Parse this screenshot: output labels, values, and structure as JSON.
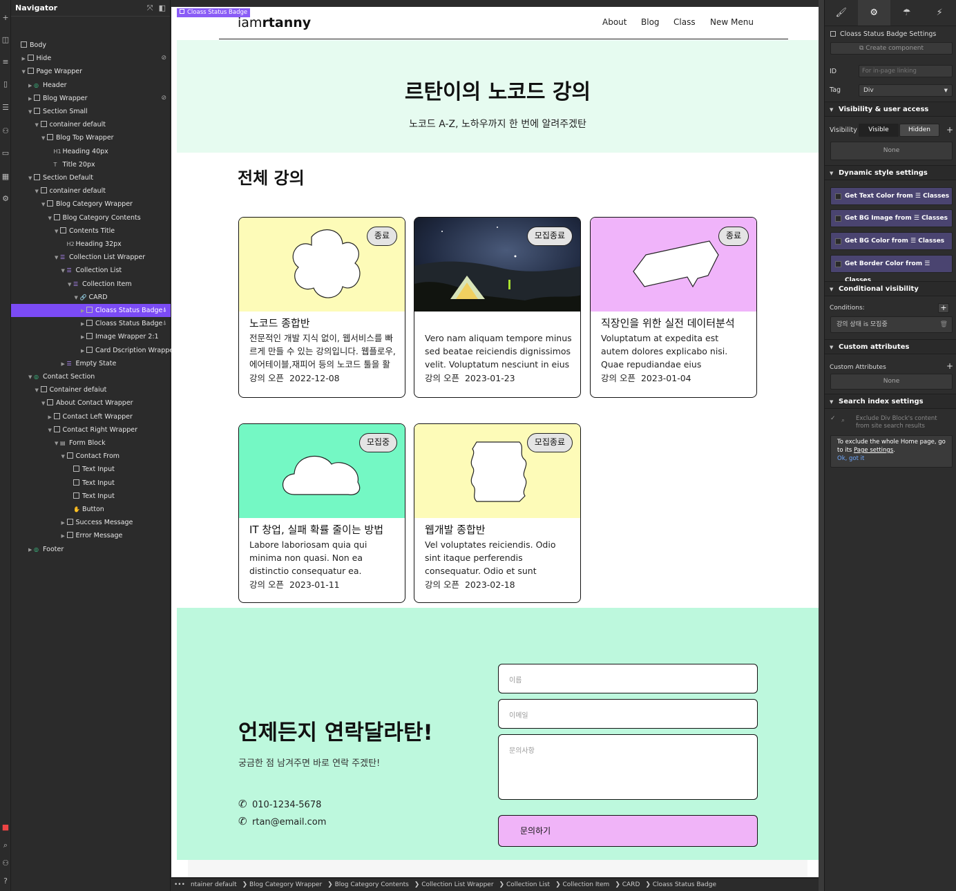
{
  "navigator": {
    "title": "Navigator",
    "items": [
      {
        "label": "Body",
        "glyph": "box",
        "indent": 0,
        "caret": false
      },
      {
        "label": "Hide",
        "glyph": "box",
        "indent": 1,
        "caret": true,
        "hidden": true
      },
      {
        "label": "Page Wrapper",
        "glyph": "box",
        "indent": 1,
        "caret": true,
        "open": true
      },
      {
        "label": "Header",
        "glyph": "comp",
        "indent": 2,
        "caret": true
      },
      {
        "label": "Blog Wrapper",
        "glyph": "box",
        "indent": 2,
        "caret": true,
        "hidden": true
      },
      {
        "label": "Section Small",
        "glyph": "box",
        "indent": 2,
        "caret": true,
        "open": true
      },
      {
        "label": "container default",
        "glyph": "box",
        "indent": 3,
        "caret": true,
        "open": true
      },
      {
        "label": "Blog Top Wrapper",
        "glyph": "box",
        "indent": 4,
        "caret": true,
        "open": true
      },
      {
        "label": "Heading 40px",
        "glyph": "H1",
        "indent": 5,
        "caret": false
      },
      {
        "label": "Title 20px",
        "glyph": "T",
        "indent": 5,
        "caret": false
      },
      {
        "label": "Section Default",
        "glyph": "box",
        "indent": 2,
        "caret": true,
        "open": true
      },
      {
        "label": "container default",
        "glyph": "box",
        "indent": 3,
        "caret": true,
        "open": true
      },
      {
        "label": "Blog Category Wrapper",
        "glyph": "box",
        "indent": 4,
        "caret": true,
        "open": true
      },
      {
        "label": "Blog Category Contents",
        "glyph": "box",
        "indent": 5,
        "caret": true,
        "open": true
      },
      {
        "label": "Contents Title",
        "glyph": "box",
        "indent": 6,
        "caret": true,
        "open": true
      },
      {
        "label": "Heading 32px",
        "glyph": "H2",
        "indent": 7,
        "caret": false
      },
      {
        "label": "Collection List Wrapper",
        "glyph": "db",
        "indent": 6,
        "caret": true,
        "open": true
      },
      {
        "label": "Collection List",
        "glyph": "db",
        "indent": 7,
        "caret": true,
        "open": true
      },
      {
        "label": "Collection Item",
        "glyph": "db",
        "indent": 8,
        "caret": true,
        "open": true
      },
      {
        "label": "CARD",
        "glyph": "link",
        "indent": 9,
        "caret": true,
        "open": true
      },
      {
        "label": "Cloass Status Badge",
        "glyph": "box",
        "indent": 10,
        "caret": true,
        "selected": true,
        "cond": true
      },
      {
        "label": "Cloass Status Badge",
        "glyph": "box",
        "indent": 10,
        "caret": true,
        "cond": true
      },
      {
        "label": "Image Wrapper 2:1",
        "glyph": "box",
        "indent": 10,
        "caret": true
      },
      {
        "label": "Card Dscription Wrapper",
        "glyph": "box",
        "indent": 10,
        "caret": true
      },
      {
        "label": "Empty State",
        "glyph": "db",
        "indent": 7,
        "caret": true
      },
      {
        "label": "Contact Section",
        "glyph": "comp",
        "indent": 2,
        "caret": true,
        "open": true
      },
      {
        "label": "Container defaiut",
        "glyph": "box",
        "indent": 3,
        "caret": true,
        "open": true
      },
      {
        "label": "About Contact Wrapper",
        "glyph": "box",
        "indent": 4,
        "caret": true,
        "open": true
      },
      {
        "label": "Contact Left Wrapper",
        "glyph": "box",
        "indent": 5,
        "caret": true
      },
      {
        "label": "Contact Right Wrapper",
        "glyph": "box",
        "indent": 5,
        "caret": true,
        "open": true
      },
      {
        "label": "Form Block",
        "glyph": "form",
        "indent": 6,
        "caret": true,
        "open": true
      },
      {
        "label": "Contact From",
        "glyph": "box",
        "indent": 7,
        "caret": true,
        "open": true
      },
      {
        "label": "Text Input",
        "glyph": "box",
        "indent": 8,
        "caret": false
      },
      {
        "label": "Text Input",
        "glyph": "box",
        "indent": 8,
        "caret": false
      },
      {
        "label": "Text Input",
        "glyph": "box",
        "indent": 8,
        "caret": false
      },
      {
        "label": "Button",
        "glyph": "hand",
        "indent": 8,
        "caret": false
      },
      {
        "label": "Success Message",
        "glyph": "box",
        "indent": 7,
        "caret": true
      },
      {
        "label": "Error Message",
        "glyph": "box",
        "indent": 7,
        "caret": true
      },
      {
        "label": "Footer",
        "glyph": "comp",
        "indent": 2,
        "caret": true
      }
    ]
  },
  "selected_tag": "Cloass Status Badge",
  "site": {
    "logo_light": "iam",
    "logo_bold": "rtanny",
    "menu": [
      "About",
      "Blog",
      "Class",
      "New Menu"
    ],
    "hero_title": "르탄이의 노코드 강의",
    "hero_subtitle": "노코드 A-Z, 노하우까지 한 번에 알려주겠탄",
    "section_title": "전체 강의",
    "date_prefix": "강의 오픈",
    "cards": [
      {
        "badge": "종료",
        "title": "노코드 종합반",
        "desc": "전문적인 개발 지식 없이, 웹서비스를 빠르게 만들 수 있는 강의입니다. 웹플로우,에어테이블,재피어 등의 노코드 툴을 활용하",
        "date": "2022-12-08",
        "bg": "#fdfbb8",
        "shape": "clover"
      },
      {
        "badge": "모집종료",
        "title": "",
        "desc": "Vero nam aliquam tempore minus sed beatae reiciendis dignissimos velit. Voluptatum nesciunt in eius",
        "date": "2023-01-23",
        "bg": "#1d2336",
        "shape": "photo"
      },
      {
        "badge": "종료",
        "title": "직장인을 위한 실전 데이터분석",
        "desc": "Voluptatum at expedita est autem dolores explicabo nisi. Quae repudiandae eius necessitatibus",
        "date": "2023-01-04",
        "bg": "#f0b4fa",
        "shape": "bubble"
      },
      {
        "badge": "모집중",
        "title": "IT 창업, 실패 확률 줄이는 방법",
        "desc": "Labore laboriosam quia qui minima non quasi. Non ea distinctio consequatur ea. Nesciunt tenetur",
        "date": "2023-01-11",
        "bg": "#74f8c4",
        "shape": "cloud"
      },
      {
        "badge": "모집종료",
        "title": "웹개발 종합반",
        "desc": "Vel voluptates reiciendis. Odio sint itaque perferendis consequatur. Odio et sunt aspernatur. Hic q",
        "date": "2023-02-18",
        "bg": "#fdfbb8",
        "shape": "wavy"
      }
    ],
    "contact_title": "언제든지 연락달라탄!",
    "contact_sub": "궁금한 점 남겨주면 바로 연락 주겠탄!",
    "phone": "010-1234-5678",
    "email": "rtan@email.com",
    "ph_name": "이름",
    "ph_email": "이메일",
    "ph_msg": "문의사항",
    "submit": "문의하기"
  },
  "settings": {
    "header": "Cloass Status Badge Settings",
    "create_component": "Create component",
    "id_label": "ID",
    "id_placeholder": "For in-page linking",
    "tag_label": "Tag",
    "tag_value": "Div",
    "vis_section": "Visibility & user access",
    "vis_label": "Visibility",
    "visible": "Visible",
    "hidden": "Hidden",
    "none": "None",
    "dyn_section": "Dynamic style settings",
    "dyn_items": [
      "Get Text Color from",
      "Get BG Image from",
      "Get BG Color from",
      "Get Border Color from"
    ],
    "classes": "Classes",
    "cond_section": "Conditional visibility",
    "conditions_label": "Conditions:",
    "condition": "강의 상태 is 모집중",
    "attr_section": "Custom attributes",
    "attr_label": "Custom Attributes",
    "attr_none": "None",
    "search_section": "Search index settings",
    "search_check": "Exclude Div Block's content from site search results",
    "search_note_1": "To exclude the whole Home page, go to its",
    "search_note_link": "Page settings",
    "search_ok": "Ok, got it"
  },
  "breadcrumb": [
    "ntainer default",
    "Blog Category Wrapper",
    "Blog Category Contents",
    "Collection List Wrapper",
    "Collection List",
    "Collection Item",
    "CARD",
    "Cloass Status Badge"
  ]
}
